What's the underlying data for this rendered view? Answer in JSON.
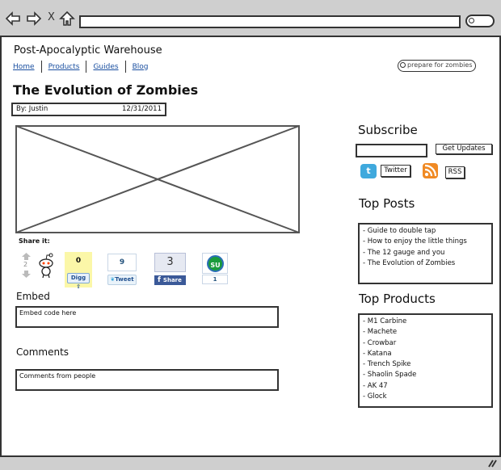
{
  "browser": {
    "back_icon": "arrow-left-icon",
    "forward_icon": "arrow-right-icon",
    "stop_label": "X",
    "home_icon": "home-icon",
    "url": "",
    "search_icon": "search-icon"
  },
  "header": {
    "site_title": "Post-Apocalyptic Warehouse",
    "nav": [
      "Home",
      "Products",
      "Guides",
      "Blog"
    ],
    "search_placeholder": "prepare for zombies"
  },
  "post": {
    "title": "The Evolution of Zombies",
    "author": "By: Justin",
    "date": "12/31/2011",
    "image_placeholder": "image-placeholder"
  },
  "share": {
    "label": "Share it:",
    "reddit_score": "2",
    "digg_count": "0",
    "digg_label": "Digg",
    "tweet_count": "9",
    "tweet_label": "Tweet",
    "facebook_count": "3",
    "facebook_label": "Share",
    "stumble_count": "1",
    "stumble_logo": "SU"
  },
  "embed": {
    "heading": "Embed",
    "value": "Embed code here"
  },
  "comments": {
    "heading": "Comments",
    "value": "Comments from people"
  },
  "subscribe": {
    "heading": "Subscribe",
    "email_value": "",
    "button_label": "Get Updates",
    "twitter_label": "Twitter",
    "rss_label": "RSS",
    "colors": {
      "twitter": "#3fa9dd",
      "rss": "#f08a24"
    }
  },
  "top_posts": {
    "heading": "Top Posts",
    "items": [
      "- Guide to double tap",
      "- How to enjoy the little things",
      "- The 12 gauge and you",
      "- The Evolution of Zombies"
    ]
  },
  "top_products": {
    "heading": "Top Products",
    "items": [
      "- M1 Carbine",
      "- Machete",
      "- Crowbar",
      "- Katana",
      "- Trench Spike",
      "- Shaolin Spade",
      "- AK 47",
      "- Glock"
    ]
  }
}
